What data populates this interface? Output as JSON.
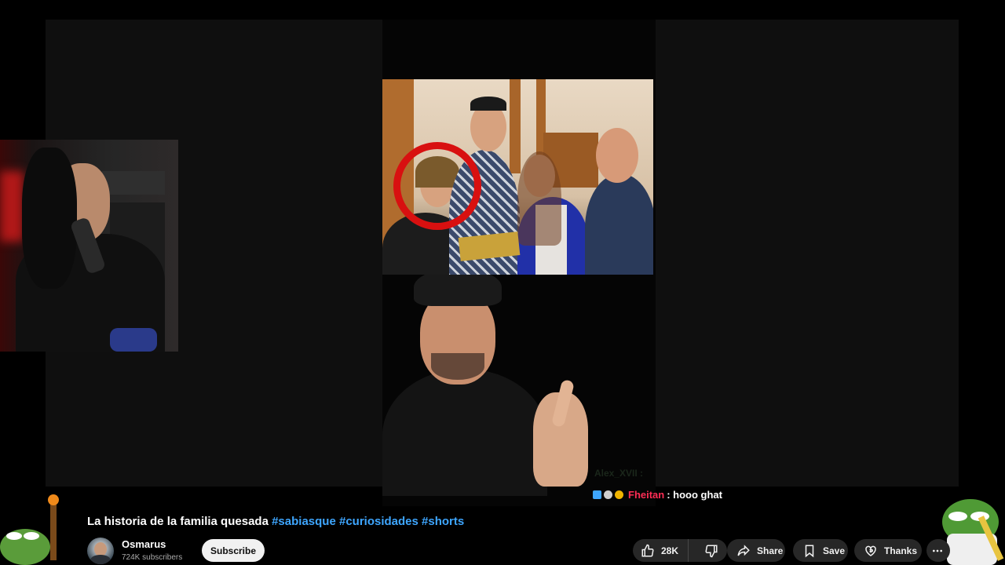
{
  "video": {
    "title": "La historia de la familia quesada",
    "hashtags": [
      "#sabiasque",
      "#curiosidades",
      "#shorts"
    ]
  },
  "channel": {
    "name": "Osmarus",
    "subscribers": "724K subscribers",
    "subscribe_label": "Subscribe"
  },
  "actions": {
    "like_count": "28K",
    "share_label": "Share",
    "save_label": "Save",
    "thanks_label": "Thanks"
  },
  "chat": {
    "ghost_user": "Alex_XVII :",
    "user": "Fheitan",
    "message": ": hooo ghat",
    "user_color": "#ff2d55"
  },
  "colors": {
    "hashtag": "#3ea6ff",
    "subscribe_bg": "#f1f1f1",
    "pill_bg": "#272727",
    "highlight_circle": "#d81010"
  }
}
